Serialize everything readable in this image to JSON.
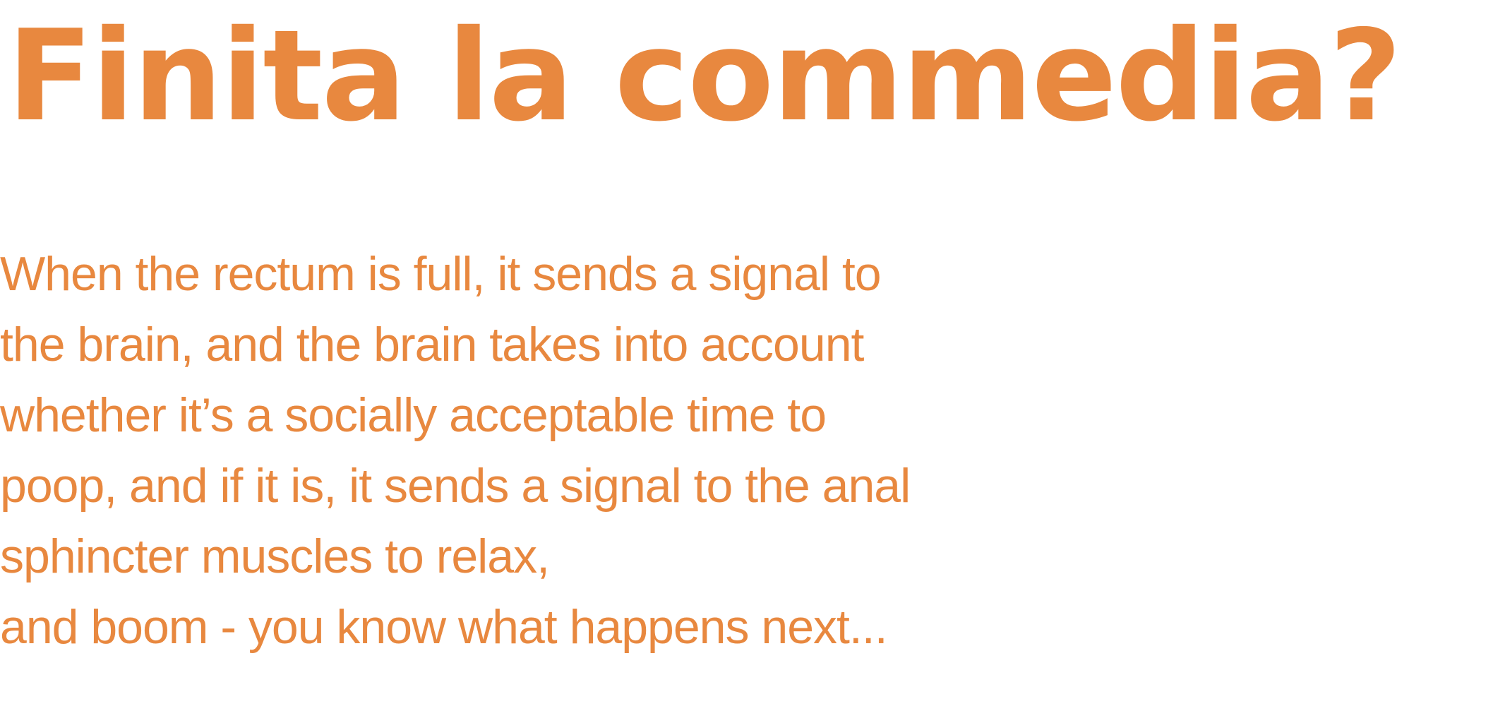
{
  "theme": {
    "text_color": "#e8883f",
    "background_color": "#ffffff"
  },
  "headline": "Finita la commedia?",
  "body": {
    "lines": [
      "When the rectum is full, it sends a signal to",
      "the brain, and the brain takes into account",
      "whether it’s a socially acceptable time to",
      "poop, and if it is, it sends a signal to the anal",
      "sphincter muscles to relax,",
      "and boom - you know what happens next..."
    ]
  }
}
